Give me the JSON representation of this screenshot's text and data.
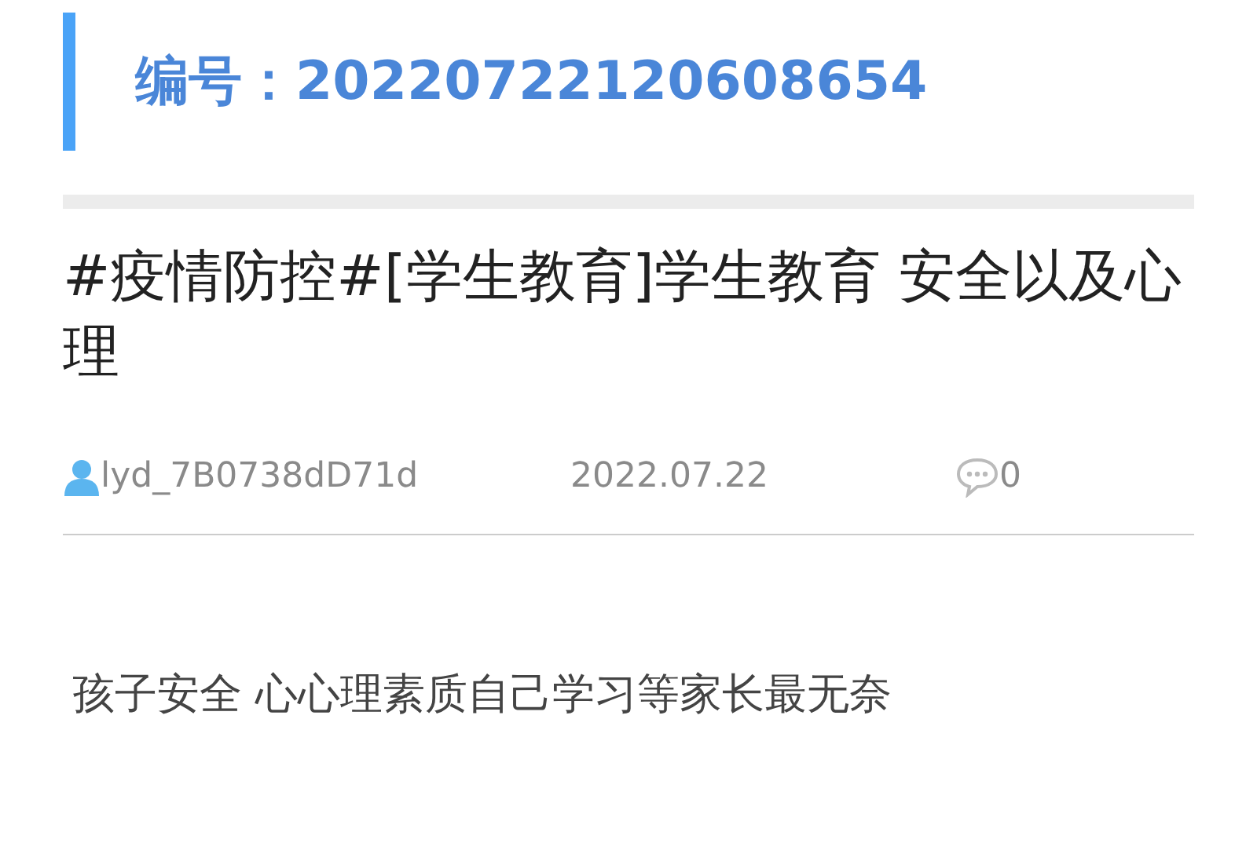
{
  "header": {
    "label": "编号：",
    "number": "20220722120608654"
  },
  "post": {
    "title": "#疫情防控#[学生教育]学生教育 安全以及心理",
    "author": "lyd_7B0738dD71d",
    "date": "2022.07.22",
    "comments": "0",
    "body": "孩子安全 心心理素质自己学习等家长最无奈"
  }
}
